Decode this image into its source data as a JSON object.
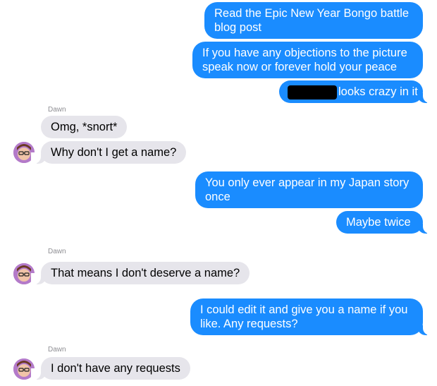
{
  "messages": [
    {
      "id": "m1",
      "text": "Read the Epic New Year Bongo battle blog post"
    },
    {
      "id": "m2",
      "text": "If you have any objections to the picture speak now or forever hold your peace"
    },
    {
      "id": "m3",
      "text": "looks crazy in it"
    },
    {
      "id": "m4",
      "text": "Omg, *snort*"
    },
    {
      "id": "m5",
      "text": "Why don't I get a name?"
    },
    {
      "id": "m6",
      "text": "You only ever appear in my Japan story once"
    },
    {
      "id": "m7",
      "text": "Maybe twice"
    },
    {
      "id": "m8",
      "text": "That means I don't deserve a name?"
    },
    {
      "id": "m9",
      "text": "I could edit it and give you a name if you like. Any requests?"
    },
    {
      "id": "m10",
      "text": "I don't have any requests"
    }
  ],
  "m1_line1": "Read the Epic New Year Bongo battle",
  "m1_line2": "blog post",
  "m2_line1": "If you have any objections to the picture",
  "m2_line2": "speak now or forever hold your peace",
  "m6_line1": "You only ever appear in my Japan story",
  "m6_line2": "once",
  "m9_line1": "I could edit it and give you a name if you",
  "m9_line2": "like. Any requests?",
  "sender_name": "Dawn",
  "colors": {
    "outgoing": "#1a8cff",
    "incoming": "#e6e5eb",
    "sender_label": "#8e8e93"
  }
}
